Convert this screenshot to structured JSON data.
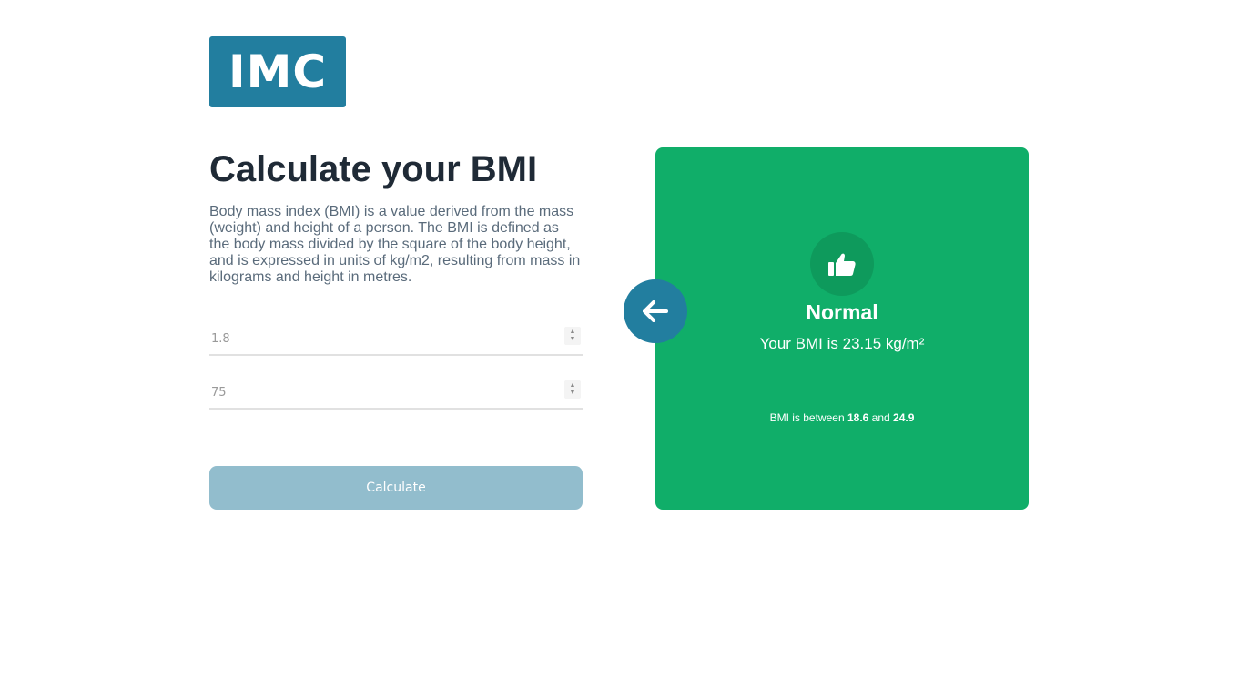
{
  "logo": {
    "text": "IMC"
  },
  "intro": {
    "title": "Calculate your BMI",
    "description": "Body mass index (BMI) is a value derived from the mass (weight) and height of a person. The BMI is defined as the body mass divided by the square of the body height, and is expressed in units of kg/m2, resulting from mass in kilograms and height in metres."
  },
  "form": {
    "height_placeholder": "1.8",
    "weight_placeholder": "75",
    "calculate_label": "Calculate"
  },
  "result": {
    "status": "Normal",
    "bmi_text": "Your BMI is 23.15 kg/m²",
    "range_prefix": "BMI is between",
    "range_min": "18.6",
    "range_and": "and",
    "range_max": "24.9"
  },
  "colors": {
    "brand": "#227e9f",
    "result_bg": "#10ae69",
    "button_disabled": "#92bdcd"
  },
  "icons": {
    "result_icon": "thumbs-up-icon",
    "back_icon": "arrow-left-icon"
  }
}
